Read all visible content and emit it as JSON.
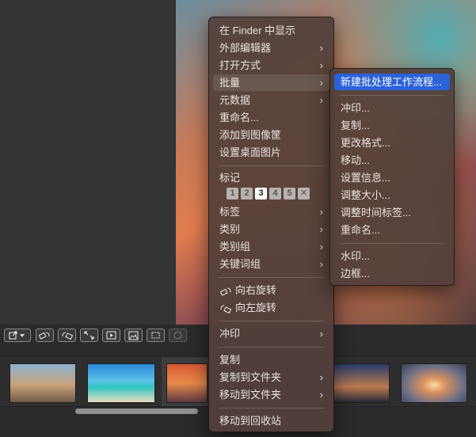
{
  "main_menu": {
    "show_in_finder": "在 Finder 中显示",
    "external_editor": "外部编辑器",
    "open_with": "打开方式",
    "batch": "批量",
    "metadata": "元数据",
    "rename": "重命名...",
    "add_to_lightbox": "添加到图像筐",
    "set_desktop": "设置桌面图片",
    "mark": "标记",
    "labels": [
      "1",
      "2",
      "3",
      "4",
      "5",
      "✕"
    ],
    "tags": "标签",
    "category": "类别",
    "category_group": "类别组",
    "keywords": "关键词组",
    "rotate_right": "向右旋转",
    "rotate_left": "向左旋转",
    "print": "冲印",
    "copy": "复制",
    "copy_to_folder": "复制到文件夹",
    "move_to_folder": "移动到文件夹",
    "move_to_trash": "移动到回收站",
    "arrow": "›"
  },
  "batch_submenu": {
    "new_workflow": "新建批处理工作流程...",
    "print": "冲印...",
    "copy": "复制...",
    "change_format": "更改格式...",
    "move": "移动...",
    "set_info": "设置信息...",
    "resize": "调整大小...",
    "adjust_timestamp": "调整时间标签...",
    "rename": "重命名...",
    "watermark": "水印...",
    "border": "边框..."
  },
  "colors": {
    "highlight_blue": "#2b62d9",
    "menu_bg": "#52403a",
    "toolbar_bg": "#2b2b2b"
  }
}
